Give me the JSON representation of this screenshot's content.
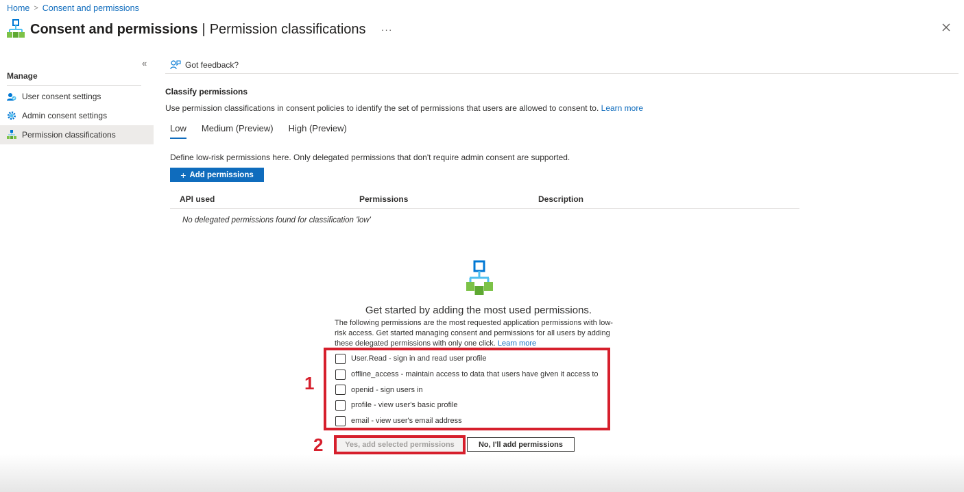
{
  "breadcrumb": {
    "home": "Home",
    "current": "Consent and permissions"
  },
  "header": {
    "title": "Consent and permissions",
    "separator": "|",
    "subtitle": "Permission classifications",
    "more": "···"
  },
  "sidebar": {
    "collapse": "«",
    "section": "Manage",
    "items": [
      {
        "label": "User consent settings",
        "icon": "user-consent-icon"
      },
      {
        "label": "Admin consent settings",
        "icon": "gear-icon"
      },
      {
        "label": "Permission classifications",
        "icon": "hierarchy-icon",
        "active": true
      }
    ]
  },
  "commandbar": {
    "feedback": "Got feedback?"
  },
  "classify": {
    "title": "Classify permissions",
    "description": "Use permission classifications in consent policies to identify the set of permissions that users are allowed to consent to.",
    "learn_more": "Learn more"
  },
  "tabs": [
    {
      "label": "Low",
      "active": true
    },
    {
      "label": "Medium (Preview)"
    },
    {
      "label": "High (Preview)"
    }
  ],
  "low_tab": {
    "define_text": "Define low-risk permissions here. Only delegated permissions that don't require admin consent are supported.",
    "add_button": "Add permissions",
    "add_button_icon": "+"
  },
  "table": {
    "columns": [
      "API used",
      "Permissions",
      "Description"
    ],
    "empty_text": "No delegated permissions found for classification 'low'"
  },
  "get_started": {
    "title": "Get started by adding the most used permissions.",
    "text": "The following permissions are the most requested application permissions with low-risk access. Get started managing consent and permissions for all users by adding these delegated permissions with only one click.",
    "learn_more": "Learn more"
  },
  "permissions": [
    {
      "label": "User.Read - sign in and read user profile",
      "checked": false
    },
    {
      "label": "offline_access - maintain access to data that users have given it access to",
      "checked": false
    },
    {
      "label": "openid - sign users in",
      "checked": false
    },
    {
      "label": "profile - view user's basic profile",
      "checked": false
    },
    {
      "label": "email - view user's email address",
      "checked": false
    }
  ],
  "buttons": {
    "yes": "Yes, add selected permissions",
    "no": "No, I'll add permissions"
  },
  "annotations": {
    "marker1": "1",
    "marker2": "2"
  },
  "colors": {
    "accent": "#0f6cbd",
    "highlight": "#d61f2c"
  }
}
